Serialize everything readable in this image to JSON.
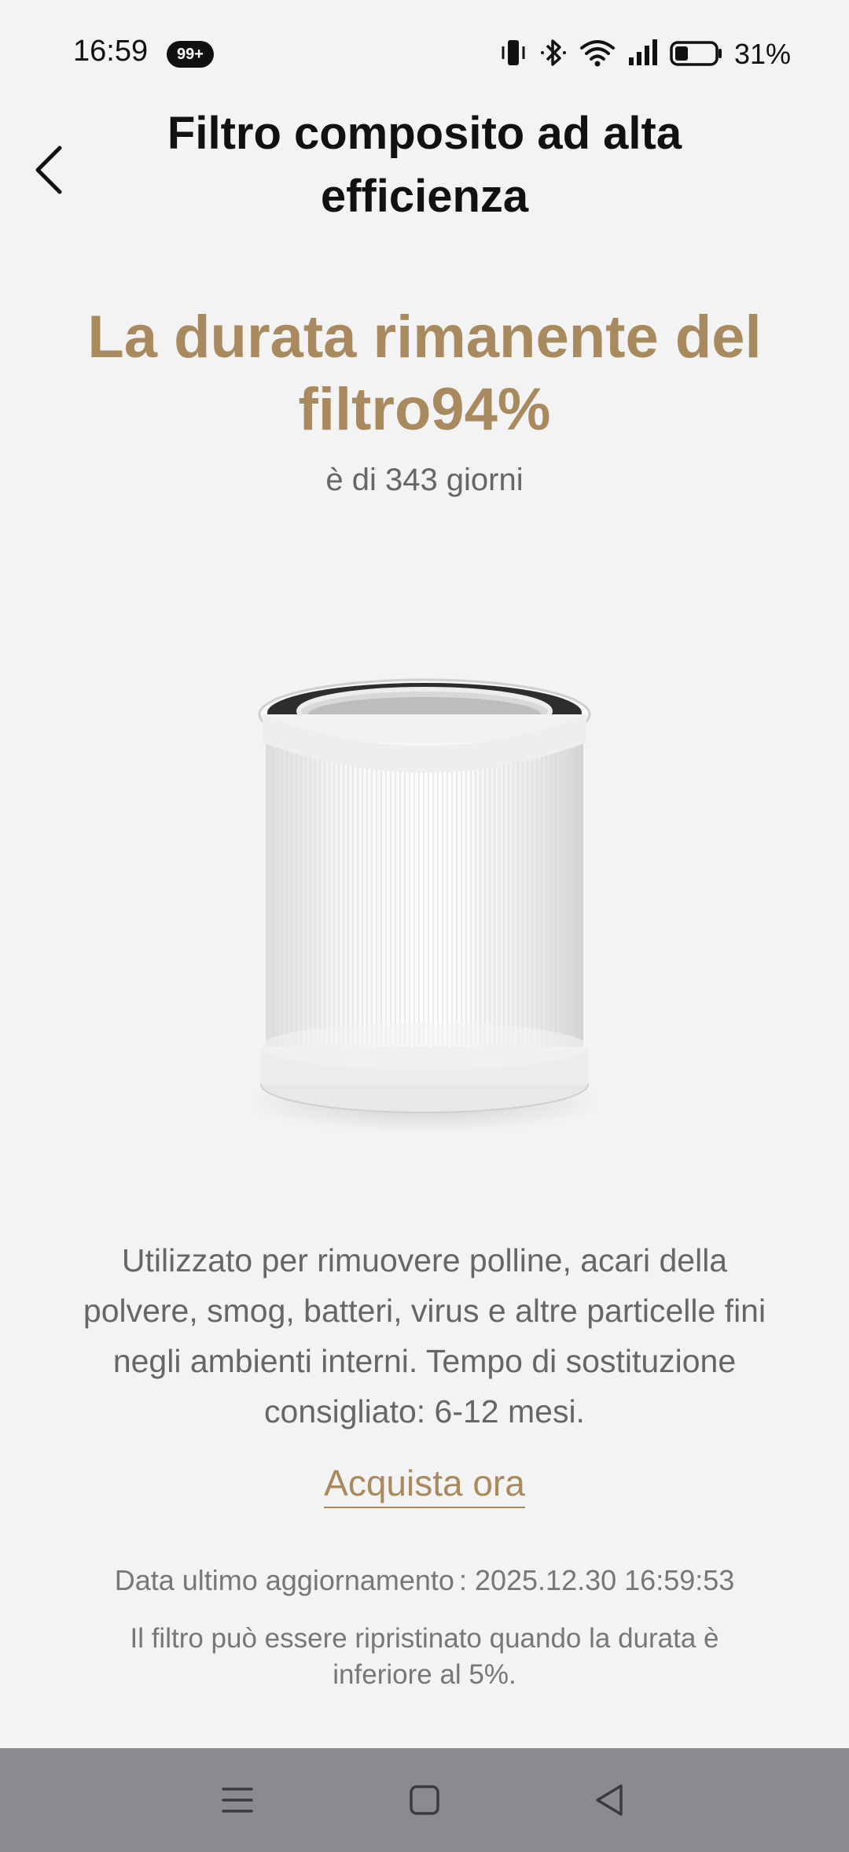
{
  "status_bar": {
    "time": "16:59",
    "notification_badge": "99+",
    "battery_percent": "31%",
    "icons": [
      "vibrate-icon",
      "bluetooth-icon",
      "wifi-icon",
      "signal-icon",
      "battery-icon"
    ]
  },
  "header": {
    "title": "Filtro composito ad alta efficienza",
    "back_icon": "chevron-left-icon"
  },
  "filter_life": {
    "title": "La durata rimanente del filtro94%",
    "days_text": "è di 343 giorni",
    "percent": 94
  },
  "description": {
    "text": "Utilizzato per rimuovere polline, acari della polvere, smog, batteri, virus e altre particelle fini negli ambienti interni. Tempo di sostituzione consigliato: 6-12 mesi."
  },
  "buy_link": {
    "label": "Acquista ora"
  },
  "update": {
    "label": "Data ultimo aggiornamento",
    "separator": ":",
    "value": "2025.12.30 16:59:53"
  },
  "reset_note": "Il filtro può essere ripristinato quando la durata è inferiore al 5%.",
  "nav_bar": {
    "icons": [
      "menu-icon",
      "home-icon",
      "back-icon"
    ]
  },
  "colors": {
    "accent": "#a98a5e",
    "background": "#f3f3f3",
    "nav_bar": "#8a8b90"
  }
}
